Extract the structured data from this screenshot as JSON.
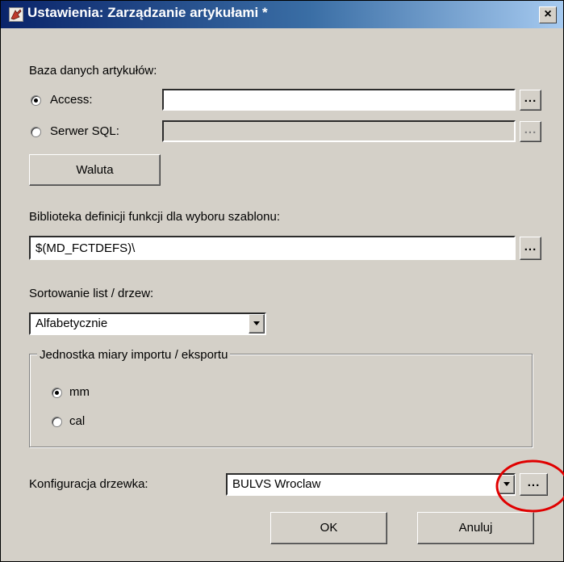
{
  "window": {
    "title": "Ustawienia: Zarządzanie artykułami *",
    "close_label": "×"
  },
  "database": {
    "section_label": "Baza danych artykułów:",
    "access_label": "Access:",
    "access_selected": true,
    "access_path": "",
    "sql_label": "Serwer SQL:",
    "sql_path": "",
    "browse_label": "...",
    "currency_button": "Waluta"
  },
  "library": {
    "label": "Biblioteka definicji funkcji dla wyboru szablonu:",
    "path": "$(MD_FCTDEFS)\\",
    "browse_label": "..."
  },
  "sorting": {
    "label": "Sortowanie list / drzew:",
    "selected": "Alfabetycznie"
  },
  "units": {
    "group_label": "Jednostka miary importu / eksportu",
    "options": [
      {
        "label": "mm",
        "selected": true
      },
      {
        "label": "cal",
        "selected": false
      }
    ]
  },
  "tree_config": {
    "label": "Konfiguracja drzewka:",
    "selected": "BULVS Wroclaw",
    "browse_label": "..."
  },
  "buttons": {
    "ok": "OK",
    "cancel": "Anuluj"
  },
  "colors": {
    "dialog_bg": "#d4d0c8",
    "titlebar_start": "#0a246a",
    "titlebar_end": "#a6caf0",
    "annotation_ring": "#e00000"
  }
}
